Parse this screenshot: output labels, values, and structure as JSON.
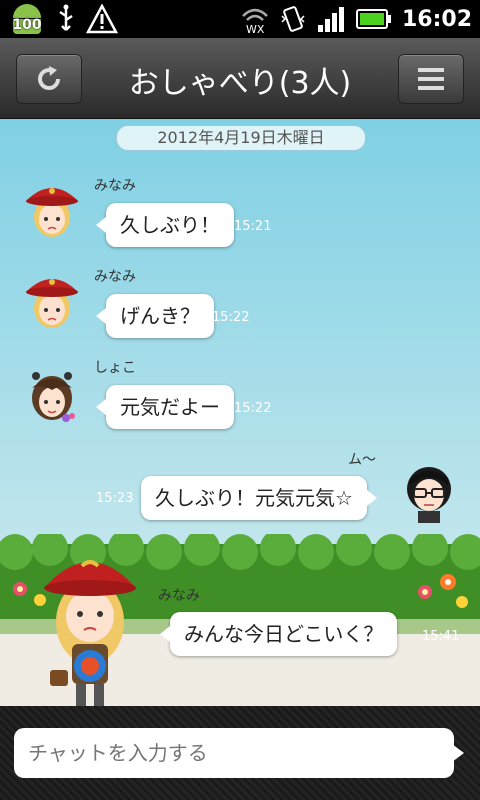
{
  "status_bar": {
    "battery_badge": "100",
    "time": "16:02",
    "icons": [
      "android-icon",
      "usb-icon",
      "warning-icon",
      "wifi-icon",
      "vibrate-icon",
      "signal-icon",
      "battery-icon"
    ]
  },
  "header": {
    "title": "おしゃべり(3人)",
    "refresh_icon": "refresh-icon",
    "menu_icon": "menu-icon"
  },
  "chat": {
    "date": "2012年4月19日木曜日",
    "messages": [
      {
        "sender": "みなみ",
        "text": "久しぶり！",
        "time": "15:21",
        "side": "left"
      },
      {
        "sender": "みなみ",
        "text": "げんき？",
        "time": "15:22",
        "side": "left"
      },
      {
        "sender": "しょこ",
        "text": "元気だよー",
        "time": "15:22",
        "side": "left"
      },
      {
        "sender": "ム～",
        "text": "久しぶり！元気元気☆",
        "time": "15:23",
        "side": "right"
      },
      {
        "sender": "みなみ",
        "text": "みんな今日どこいく？",
        "time": "15:41",
        "side": "left"
      }
    ]
  },
  "input": {
    "placeholder": "チャットを入力する"
  },
  "colors": {
    "sky_top": "#7fd0e4",
    "hedge": "#4e9a2e",
    "accent_green": "#8bc34a"
  }
}
